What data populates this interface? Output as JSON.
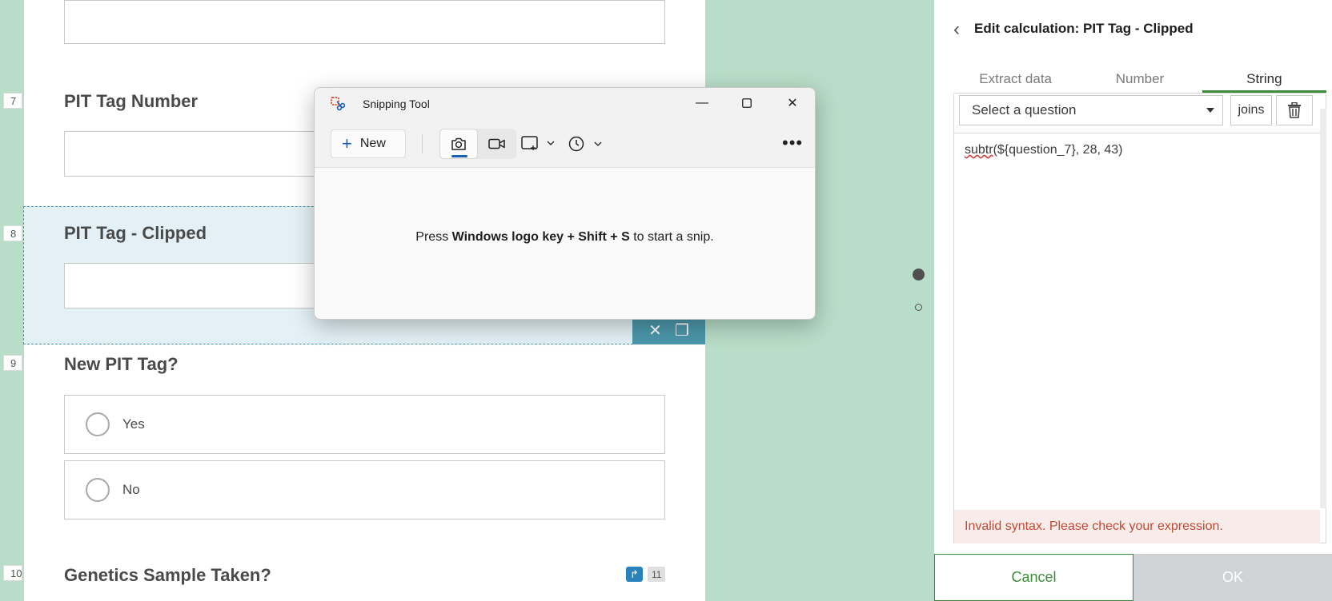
{
  "form": {
    "questions": [
      {
        "number": "7",
        "title": "PIT Tag Number"
      },
      {
        "number": "8",
        "title": "PIT Tag - Clipped"
      },
      {
        "number": "9",
        "title": "New PIT Tag?",
        "options": [
          "Yes",
          "No"
        ]
      },
      {
        "number": "10",
        "title": "Genetics Sample Taken?"
      }
    ],
    "rule_count": "11"
  },
  "panel": {
    "title": "Edit calculation: PIT Tag - Clipped",
    "tabs": [
      "Extract data",
      "Number",
      "String"
    ],
    "active_tab": "String",
    "select_placeholder": "Select a question",
    "joins_label": "joins",
    "expression_fn": "subtr",
    "expression_rest": "(${question_7}, 28, 43)",
    "error": "Invalid syntax. Please check your expression.",
    "cancel_label": "Cancel",
    "ok_label": "OK"
  },
  "snipping_tool": {
    "title": "Snipping Tool",
    "new_label": "New",
    "hint_prefix": "Press ",
    "hint_keys": "Windows logo key + Shift + S",
    "hint_suffix": " to start a snip."
  },
  "colors": {
    "background": "#b8ddc8",
    "accent_green": "#3c8c3c",
    "selection_blue": "#4b97aa",
    "error_red": "#c24a34",
    "windows_blue": "#1a5fb4"
  }
}
